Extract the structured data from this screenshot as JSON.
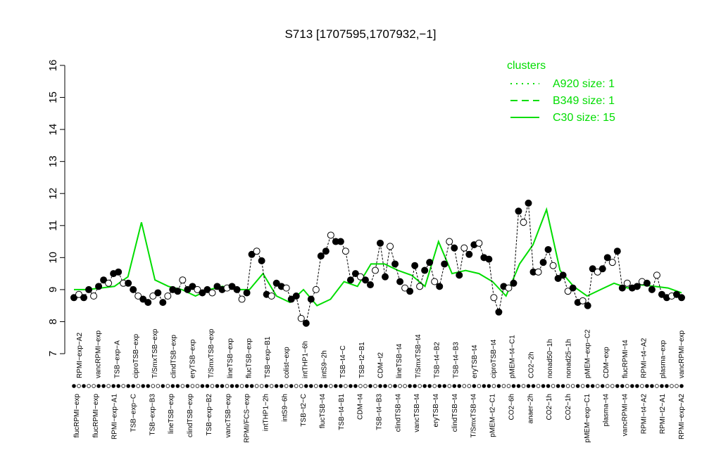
{
  "chart_data": {
    "type": "line",
    "title": "S713 [1707595,1707932,−1]",
    "xlabel": "",
    "ylabel": "",
    "ylim": [
      7,
      16
    ],
    "yticks": [
      7,
      8,
      9,
      10,
      11,
      12,
      13,
      14,
      15,
      16
    ],
    "grid": false,
    "legend": {
      "placement": "top-right",
      "title": "clusters",
      "entries": [
        {
          "label": "A920 size: 1",
          "style": "dotted"
        },
        {
          "label": "B349 size: 1",
          "style": "dashed"
        },
        {
          "label": "C30 size: 15",
          "style": "solid"
        }
      ]
    },
    "colors": {
      "line": "#00dd00",
      "point_fill": "#000000",
      "point_open": "#ffffff"
    },
    "x_labels_top": [
      "RPMI−exp−A2",
      "vancRPMI−exp",
      "TSB−exp−A",
      "ciproTSB−exp",
      "T/SmxTSB−exp",
      "clindTSB−exp",
      "eryTSB−exp",
      "T/SmxTSB−exp",
      "lineTSB−exp",
      "flucTSB−exp",
      "TSB−exp−B1",
      "colist−exp",
      "intTHP1−6h",
      "intS9−2h",
      "TSB−t4−C",
      "TSB−t2−B1",
      "CDM−t2",
      "lineTSB−t4",
      "T/SmxTSB−t4",
      "TSB−t4−B2",
      "TSB−t4−B3",
      "eryTSB−t4",
      "ciproTSB−t4",
      "pMEM−t4−C1",
      "CO2−2h",
      "nonad50−1h",
      "nonad25−1h",
      "pMEM−exp−C2",
      "CDM−exp",
      "flucRPMI−t4",
      "RPMI−t4−A2",
      "plasma−exp",
      "vancRPMI−exp"
    ],
    "x_labels_bottom": [
      "flucRPMI−exp",
      "flucRPMI−exp",
      "RPMI−exp−A1",
      "TSB−exp−C",
      "TSB−exp−B3",
      "lineTSB−exp",
      "clindTSB−exp",
      "TSB−exp−B2",
      "vancTSB−exp",
      "RPMI/FCS−exp",
      "intTHP1−2h",
      "intS9−6h",
      "TSB−t2−C",
      "flucTSB−t4",
      "TSB−t4−B1",
      "CDM−t4",
      "TSB−t4−B3",
      "clindTSB−t4",
      "vancTSB−t4",
      "eryTSB−t4",
      "clindTSB−t4",
      "T/SmxTSB−t4",
      "pMEM−t2−C1",
      "CO2−6h",
      "anaer−2h",
      "CO2−1h",
      "CO2−1h",
      "pMEM−exp−C1",
      "plasma−t4",
      "vancRPMI−t4",
      "RPMI−t4−A2",
      "RPMI−t2−A1",
      "RPMI−exp−A2"
    ],
    "series": [
      {
        "points": [
          8.75,
          8.85,
          8.75,
          9.0,
          8.8,
          9.1,
          9.3,
          9.2,
          9.5,
          9.55,
          9.2,
          9.2,
          9.0,
          8.8,
          8.7,
          8.6,
          8.8,
          8.9,
          8.6,
          8.8,
          9.0,
          8.95,
          9.3,
          9.0,
          9.1,
          9.0,
          8.9,
          9.0,
          8.9,
          9.1,
          9.0,
          9.05,
          9.1,
          9.0,
          8.7,
          8.9,
          10.1,
          10.2,
          9.9,
          8.85,
          8.8,
          9.2,
          9.1,
          9.05,
          8.7,
          8.8,
          8.1,
          7.95,
          8.7,
          9.0,
          10.05,
          10.2,
          10.7,
          10.5,
          10.5,
          10.2,
          9.3,
          9.5,
          9.4,
          9.3,
          9.15,
          9.6,
          10.45,
          9.4,
          10.35,
          9.8,
          9.25,
          9.05,
          8.95,
          9.75,
          9.1,
          9.6,
          9.85,
          9.25,
          9.1,
          9.8,
          10.5,
          10.3,
          9.45,
          10.3,
          10.1,
          10.4,
          10.45,
          10.0,
          9.95,
          8.75,
          8.3,
          9.1,
          9.05,
          9.2,
          11.45,
          11.1,
          11.7,
          9.55,
          9.55,
          9.85,
          10.25,
          9.75,
          9.35,
          9.45,
          8.95,
          9.05,
          8.6,
          8.65,
          8.5,
          9.65,
          9.55,
          9.65,
          10.0,
          9.85,
          10.2,
          9.05,
          9.2,
          9.05,
          9.1,
          9.25,
          9.2,
          9.0,
          9.45,
          8.85,
          8.75,
          8.8,
          8.85,
          8.75
        ],
        "mean": [
          9.0,
          9.0,
          9.05,
          9.1,
          9.4,
          11.1,
          9.3,
          9.1,
          9.0,
          8.8,
          9.0,
          9.1,
          9.0,
          9.0,
          9.5,
          8.8,
          8.6,
          9.0,
          8.5,
          8.7,
          9.25,
          9.1,
          9.8,
          9.8,
          9.6,
          9.45,
          9.1,
          10.5,
          9.5,
          9.6,
          9.5,
          9.25,
          8.8,
          9.8,
          10.4,
          11.5,
          9.6,
          9.1,
          8.8,
          9.0,
          9.2,
          9.05,
          9.15,
          9.1,
          9.05,
          8.9
        ]
      }
    ]
  }
}
